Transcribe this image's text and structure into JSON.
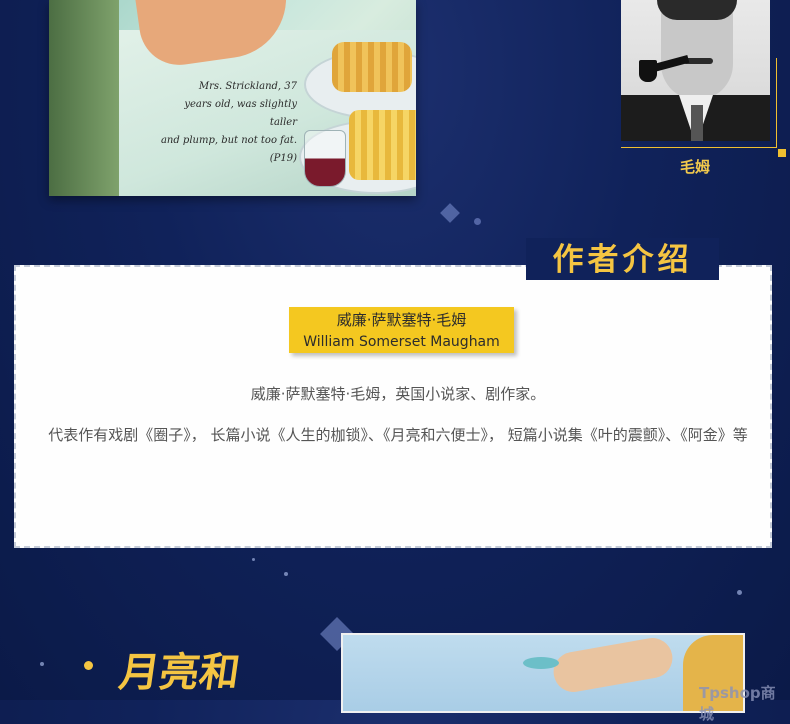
{
  "top_illustration": {
    "caption_lines": [
      "Mrs. Strickland, 37",
      "years old, was slightly taller",
      "and plump, but not too fat.",
      "(P19)"
    ]
  },
  "portrait": {
    "name": "毛姆"
  },
  "author_section": {
    "title": "作者介绍",
    "name_cn": "威廉·萨默塞特·毛姆",
    "name_en": "William Somerset Maugham",
    "bio_line1": "威廉·萨默塞特·毛姆，英国小说家、剧作家。",
    "bio_line2": "代表作有戏剧《圈子》， 长篇小说《人生的枷锁》、《月亮和六便士》， 短篇小说集《叶的震颤》、《阿金》等"
  },
  "bottom": {
    "heading_partial": "月亮和"
  },
  "watermark": "Tpshop商城",
  "colors": {
    "background": "#10225a",
    "accent_gold": "#f5c542",
    "label_yellow": "#f4c820"
  }
}
